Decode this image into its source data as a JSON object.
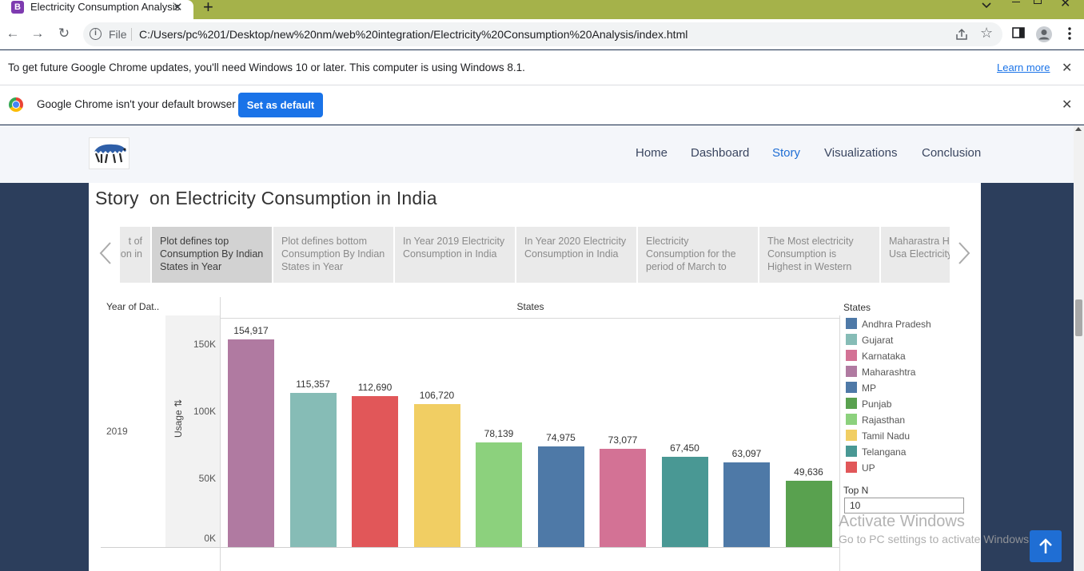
{
  "browser": {
    "tab_title": "Electricity Consumption Analysis",
    "tab_favicon_letter": "B",
    "file_label": "File",
    "url": "C:/Users/pc%201/Desktop/new%20nm/web%20integration/Electricity%20Consumption%20Analysis/index.html"
  },
  "infobar": {
    "update_message": "To get future Google Chrome updates, you'll need Windows 10 or later. This computer is using Windows 8.1.",
    "learn_more": "Learn more",
    "default_message": "Google Chrome isn't your default browser",
    "set_default": "Set as default"
  },
  "nav": {
    "items": [
      "Home",
      "Dashboard",
      "Story",
      "Visualizations",
      "Conclusion"
    ],
    "active": "Story"
  },
  "story": {
    "title": "Story  on Electricity Consumption in India",
    "points": [
      "t of\ntion in",
      "Plot defines top Consumption By Indian States in Year",
      "Plot defines bottom Consumption By Indian States in Year",
      "In Year 2019 Electricity Consumption in India",
      "In Year 2020 Electricity Consumption in India",
      "Electricity Consumption for the period of March to",
      "The Most electricity Consumption is Highest in Western",
      "Maharastra Highest Usa Electricity a"
    ],
    "active_index": 1
  },
  "viz": {
    "row_header": "Year of Dat..",
    "column_header": "States",
    "row_value": "2019",
    "y_axis_title": "Usage",
    "y_ticks": [
      "150K",
      "100K",
      "50K",
      "0K"
    ],
    "legend_title": "States",
    "legend": [
      {
        "name": "Andhra Pradesh",
        "color": "#4e79a7"
      },
      {
        "name": "Gujarat",
        "color": "#86bcb6"
      },
      {
        "name": "Karnataka",
        "color": "#d37295"
      },
      {
        "name": "Maharashtra",
        "color": "#b07aa1"
      },
      {
        "name": "MP",
        "color": "#4e79a7"
      },
      {
        "name": "Punjab",
        "color": "#59a14f"
      },
      {
        "name": "Rajasthan",
        "color": "#8cd17d"
      },
      {
        "name": "Tamil Nadu",
        "color": "#f1ce63"
      },
      {
        "name": "Telangana",
        "color": "#499894"
      },
      {
        "name": "UP",
        "color": "#e15759"
      }
    ],
    "top_n_label": "Top N",
    "top_n_value": "10"
  },
  "chart_data": {
    "type": "bar",
    "ylim": [
      0,
      160000
    ],
    "ylabel": "Usage",
    "values": [
      154917,
      115357,
      112690,
      106720,
      78139,
      74975,
      73077,
      67450,
      63097,
      49636
    ],
    "data_labels": [
      "154,917",
      "115,357",
      "112,690",
      "106,720",
      "78,139",
      "74,975",
      "73,077",
      "67,450",
      "63,097",
      "49,636"
    ],
    "colors": [
      "#b07aa1",
      "#86bcb6",
      "#e15759",
      "#f1ce63",
      "#8cd17d",
      "#4e79a7",
      "#d37295",
      "#499894",
      "#4e79a7",
      "#59a14f"
    ]
  },
  "watermark": {
    "line1": "Activate Windows",
    "line2": "Go to PC settings to activate Windows."
  }
}
